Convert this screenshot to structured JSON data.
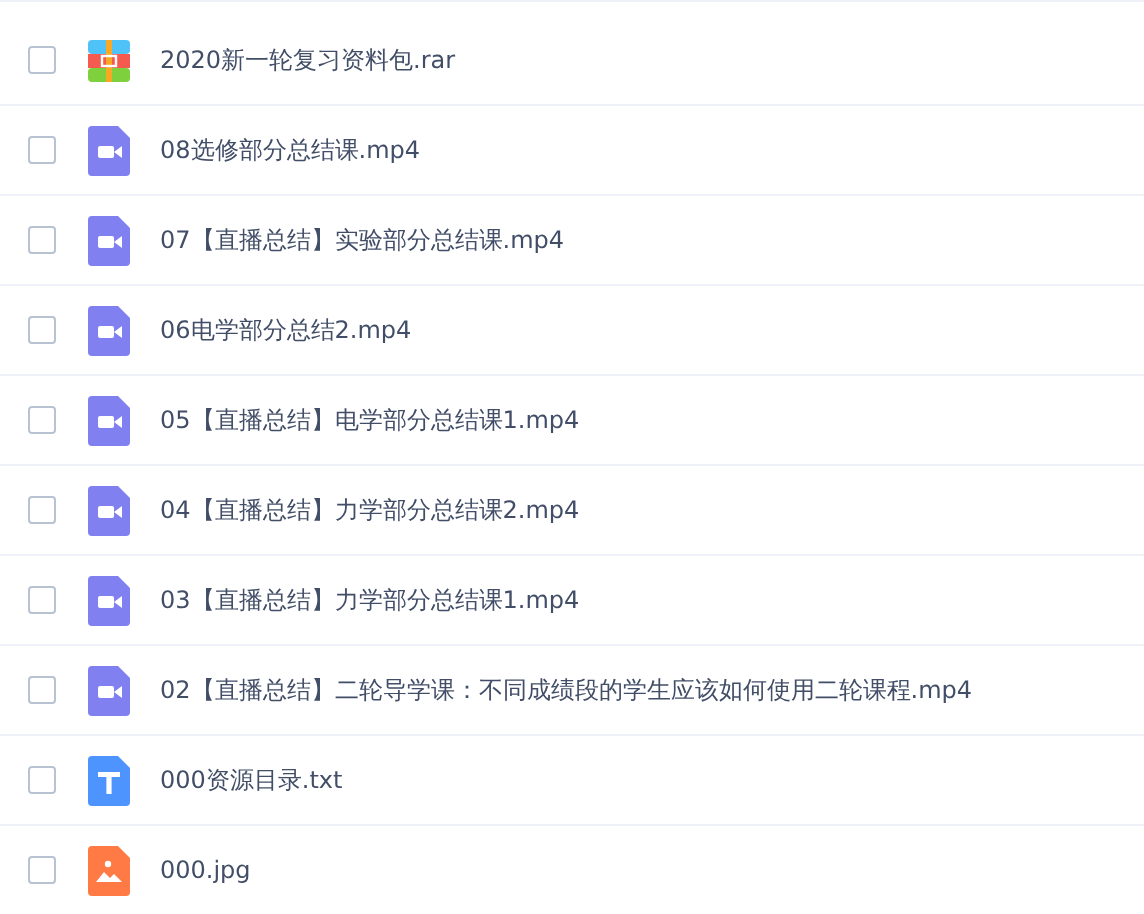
{
  "files": [
    {
      "kind": "archive",
      "name": "2020新一轮复习资料包.rar",
      "checked": false
    },
    {
      "kind": "video",
      "name": "08选修部分总结课.mp4",
      "checked": false
    },
    {
      "kind": "video",
      "name": "07【直播总结】实验部分总结课.mp4",
      "checked": false
    },
    {
      "kind": "video",
      "name": "06电学部分总结2.mp4",
      "checked": false
    },
    {
      "kind": "video",
      "name": "05【直播总结】电学部分总结课1.mp4",
      "checked": false
    },
    {
      "kind": "video",
      "name": "04【直播总结】力学部分总结课2.mp4",
      "checked": false
    },
    {
      "kind": "video",
      "name": "03【直播总结】力学部分总结课1.mp4",
      "checked": false
    },
    {
      "kind": "video",
      "name": "02【直播总结】二轮导学课：不同成绩段的学生应该如何使用二轮课程.mp4",
      "checked": false
    },
    {
      "kind": "text",
      "name": "000资源目录.txt",
      "checked": false
    },
    {
      "kind": "image",
      "name": "000.jpg",
      "checked": false
    }
  ]
}
